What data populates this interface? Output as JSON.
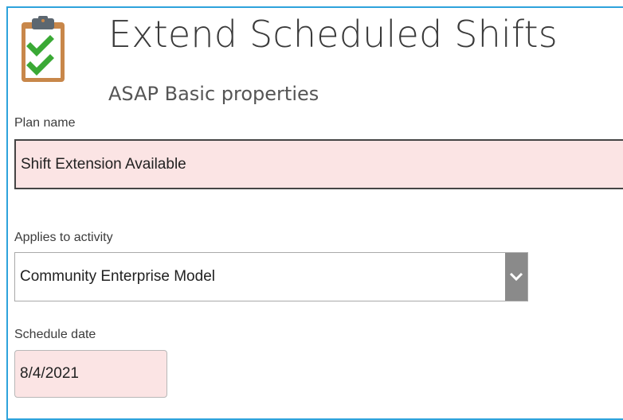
{
  "header": {
    "title": "Extend Scheduled Shifts",
    "subtitle": "ASAP Basic properties",
    "icon": "clipboard-checklist-icon"
  },
  "form": {
    "plan_name": {
      "label": "Plan name",
      "value": "Shift Extension Available"
    },
    "applies_to_activity": {
      "label": "Applies to activity",
      "selected": "Community Enterprise Model"
    },
    "schedule_date": {
      "label": "Schedule date",
      "value": "8/4/2021"
    }
  },
  "colors": {
    "frame_border": "#2ea3dc",
    "required_field_bg": "#fbe4e4",
    "dropdown_arrow_bg": "#8a8a8a",
    "check_green": "#3aa935",
    "clipboard_brown": "#c8874a"
  }
}
